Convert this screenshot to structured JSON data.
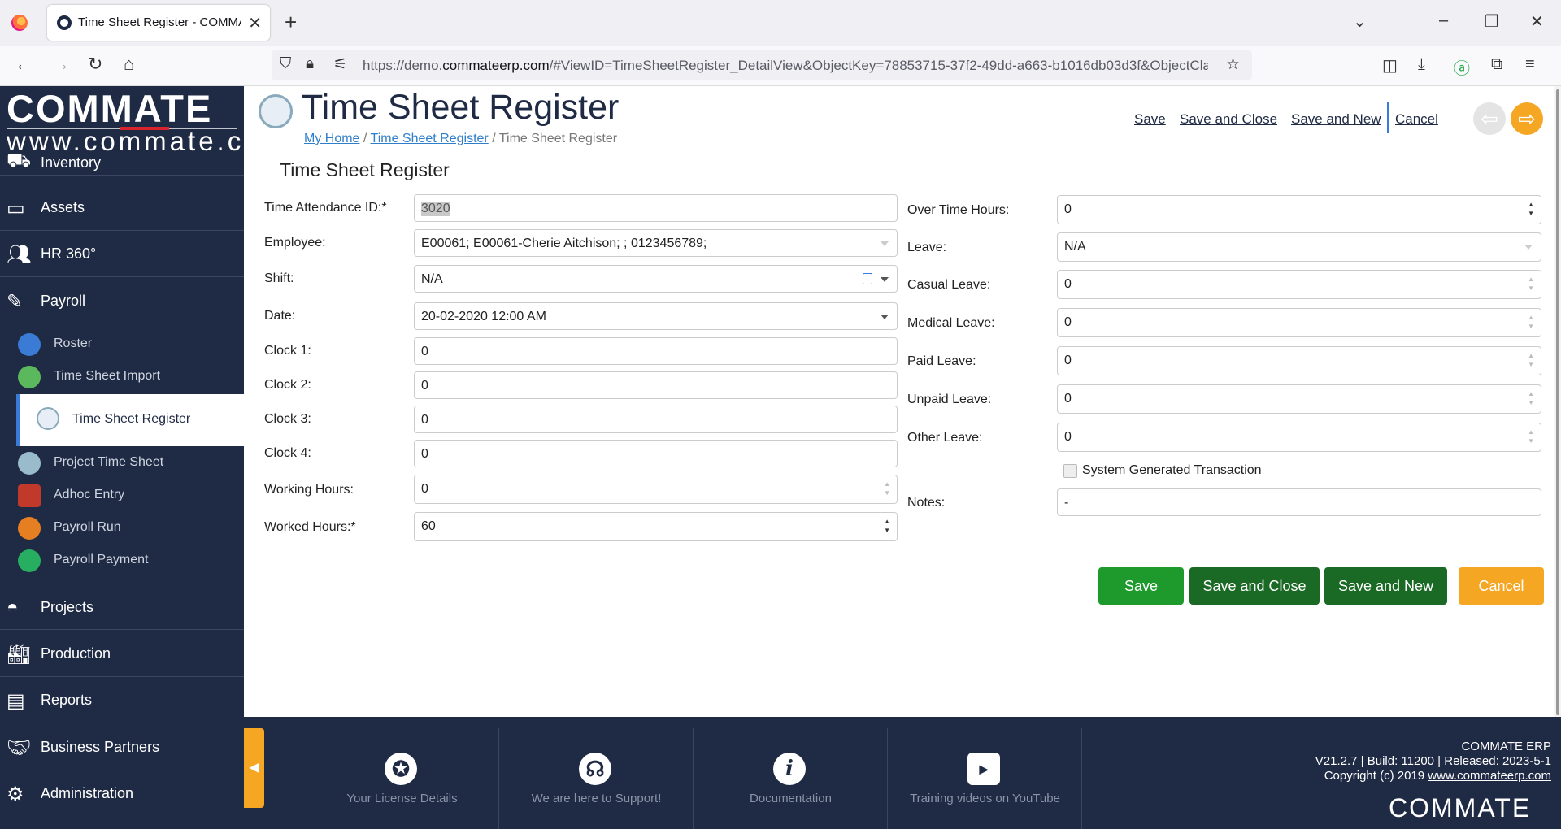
{
  "browser": {
    "tab_title": "Time Sheet Register - COMMATE",
    "url_prefix": "https://demo.",
    "url_domain": "commateerp.com",
    "url_rest": "/#ViewID=TimeSheetRegister_DetailView&ObjectKey=78853715-37f2-49dd-a663-b1016db03d3f&ObjectClassName=..."
  },
  "sidebar": {
    "logo_main": "COMMATE",
    "logo_sub": "www.commate.ca",
    "menu": [
      {
        "label": "Inventory",
        "icon": "forklift-icon"
      },
      {
        "label": "Assets",
        "icon": "monitor-icon"
      },
      {
        "label": "HR 360°",
        "icon": "people-icon"
      },
      {
        "label": "Payroll",
        "icon": "payroll-icon"
      },
      {
        "label": "Projects",
        "icon": "helmet-icon"
      },
      {
        "label": "Production",
        "icon": "factory-icon"
      },
      {
        "label": "Reports",
        "icon": "report-icon"
      },
      {
        "label": "Business Partners",
        "icon": "partners-icon"
      },
      {
        "label": "Administration",
        "icon": "admin-icon"
      }
    ],
    "submenu": [
      {
        "label": "Roster"
      },
      {
        "label": "Time Sheet Import"
      },
      {
        "label": "Time Sheet Register"
      },
      {
        "label": "Project Time Sheet"
      },
      {
        "label": "Adhoc Entry"
      },
      {
        "label": "Payroll Run"
      },
      {
        "label": "Payroll Payment"
      }
    ]
  },
  "header": {
    "title": "Time Sheet Register",
    "breadcrumb": {
      "home": "My Home",
      "sep": "/",
      "list": "Time Sheet Register",
      "current": "Time Sheet Register"
    },
    "actions": {
      "save": "Save",
      "save_close": "Save and Close",
      "save_new": "Save and New",
      "cancel": "Cancel"
    }
  },
  "form": {
    "section_title": "Time Sheet Register",
    "left": {
      "time_attendance_id": {
        "label": "Time Attendance ID:*",
        "value": "3020"
      },
      "employee": {
        "label": "Employee:",
        "value": "E00061; E00061-Cherie Aitchison; ; 0123456789;"
      },
      "shift": {
        "label": "Shift:",
        "value": "N/A"
      },
      "date": {
        "label": "Date:",
        "value": "20-02-2020 12:00 AM"
      },
      "clock1": {
        "label": "Clock 1:",
        "value": "0"
      },
      "clock2": {
        "label": "Clock 2:",
        "value": "0"
      },
      "clock3": {
        "label": "Clock 3:",
        "value": "0"
      },
      "clock4": {
        "label": "Clock 4:",
        "value": "0"
      },
      "working_hours": {
        "label": "Working Hours:",
        "value": "0"
      },
      "worked_hours": {
        "label": "Worked Hours:*",
        "value": "60"
      }
    },
    "right": {
      "over_time_hours": {
        "label": "Over Time Hours:",
        "value": "0"
      },
      "leave": {
        "label": "Leave:",
        "value": "N/A"
      },
      "casual_leave": {
        "label": "Casual Leave:",
        "value": "0"
      },
      "medical_leave": {
        "label": "Medical Leave:",
        "value": "0"
      },
      "paid_leave": {
        "label": "Paid Leave:",
        "value": "0"
      },
      "unpaid_leave": {
        "label": "Unpaid Leave:",
        "value": "0"
      },
      "other_leave": {
        "label": "Other Leave:",
        "value": "0"
      },
      "system_generated": {
        "label": "System Generated Transaction",
        "checked": false
      },
      "notes": {
        "label": "Notes:",
        "value": "-"
      }
    },
    "buttons": {
      "save": "Save",
      "save_close": "Save and Close",
      "save_new": "Save and New",
      "cancel": "Cancel"
    },
    "colors": {
      "save": "#1e9a2c",
      "save_dark": "#1a6a26",
      "cancel": "#f5a623"
    }
  },
  "footer": {
    "links": [
      {
        "label": "Your License Details",
        "icon": "ribbon-icon"
      },
      {
        "label": "We are here to Support!",
        "icon": "support-icon"
      },
      {
        "label": "Documentation",
        "icon": "info-icon"
      },
      {
        "label": "Training videos on YouTube",
        "icon": "youtube-icon"
      }
    ],
    "info": {
      "product": "COMMATE ERP",
      "version": "V21.2.7 | Build: 11200 | Released: 2023-5-1",
      "copyright": "Copyright (c) 2019 ",
      "site": "www.commateerp.com",
      "logo": "COMMATE"
    }
  }
}
